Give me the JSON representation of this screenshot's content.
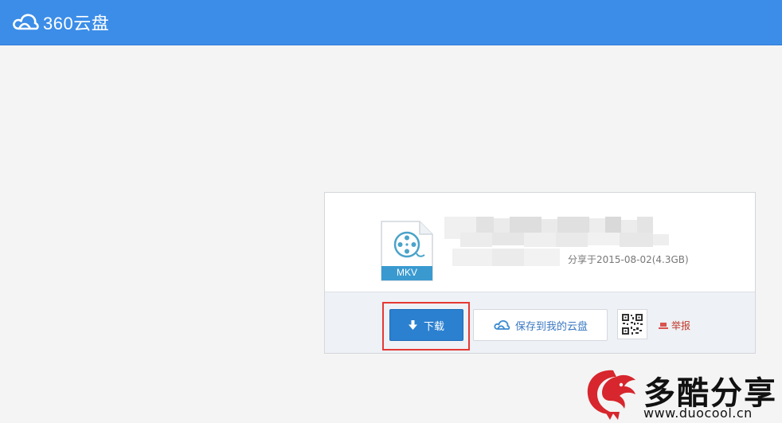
{
  "header": {
    "brand": "360云盘"
  },
  "file": {
    "type_label": "MKV",
    "share_info": "分享于2015-08-02(4.3GB)"
  },
  "actions": {
    "download_label": "下载",
    "save_label": "保存到我的云盘",
    "report_label": "举报"
  },
  "watermark": {
    "text": "多酷分享",
    "url": "www.duocool.cn"
  },
  "colors": {
    "header_bg": "#3b8de8",
    "download_bg": "#2b80d0",
    "file_icon_teal": "#4aa3c9",
    "highlight_red": "#e53935",
    "report_red": "#c0392b"
  }
}
